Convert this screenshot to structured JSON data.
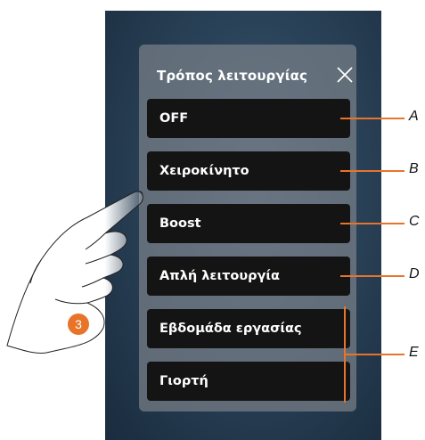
{
  "panel": {
    "title": "Τρόπος λειτουργίας"
  },
  "modes": [
    {
      "label": "OFF",
      "callout": "A"
    },
    {
      "label": "Χειροκίνητο",
      "callout": "B"
    },
    {
      "label": "Boost",
      "callout": "C"
    },
    {
      "label": "Απλή λειτουργία",
      "callout": "D"
    },
    {
      "label": "Εβδομάδα εργασίας"
    },
    {
      "label": "Γιορτή"
    }
  ],
  "group_callout": "E",
  "step_number": "3",
  "colors": {
    "accent": "#e8742a",
    "button_bg": "#141414",
    "screen_bg": "#2a4258"
  },
  "icons": {
    "close": "close-icon"
  }
}
